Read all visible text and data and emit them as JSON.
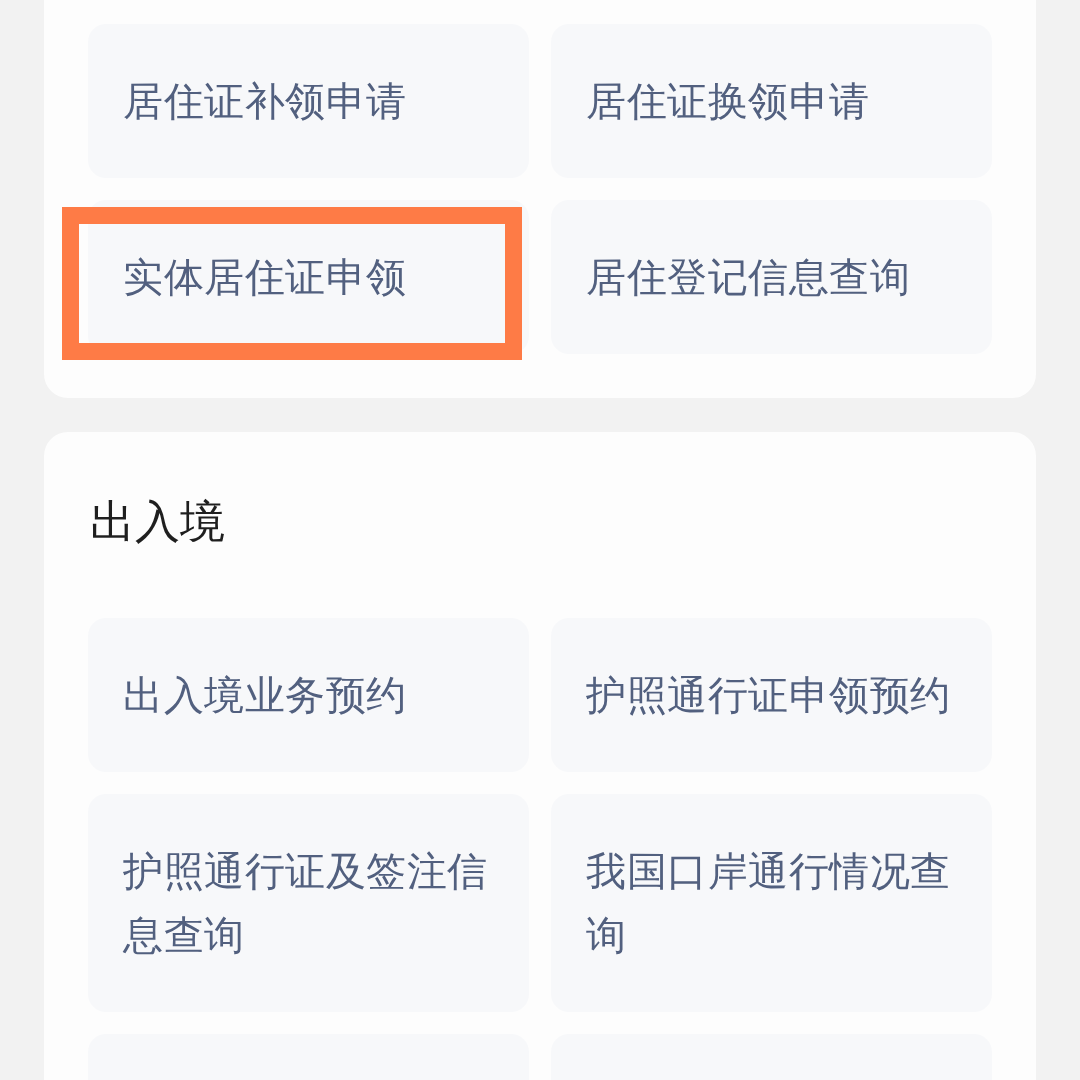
{
  "sections": [
    {
      "items": [
        {
          "kind": "service",
          "label": "居住证补领申请",
          "highlighted": false
        },
        {
          "kind": "service",
          "label": "居住证换领申请",
          "highlighted": false
        },
        {
          "kind": "service",
          "label": "实体居住证申领",
          "highlighted": true
        },
        {
          "kind": "service",
          "label": "居住登记信息查询",
          "highlighted": false
        }
      ]
    },
    {
      "title": "出入境",
      "items": [
        {
          "kind": "service",
          "label": "出入境业务预约",
          "highlighted": false
        },
        {
          "kind": "service",
          "label": "护照通行证申领预约",
          "highlighted": false
        },
        {
          "kind": "service",
          "label": "护照通行证及签注信息查询",
          "highlighted": false
        },
        {
          "kind": "service",
          "label": "我国口岸通行情况查询",
          "highlighted": false
        },
        {
          "kind": "cut-off",
          "highlighted": false
        },
        {
          "kind": "cut-off",
          "highlighted": false
        }
      ]
    }
  ]
}
